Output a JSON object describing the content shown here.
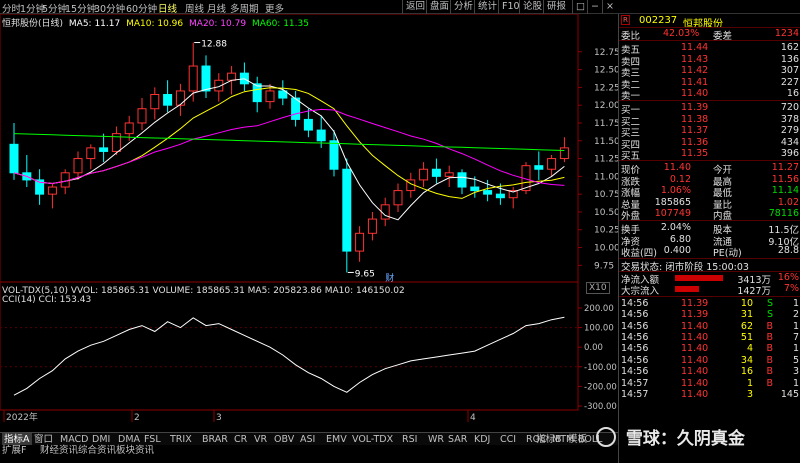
{
  "toolbar": {
    "periods": [
      "分时",
      "1分钟",
      "5分钟",
      "15分钟",
      "30分钟",
      "60分钟",
      "日线",
      "周线",
      "月线",
      "多周期",
      "更多"
    ],
    "active_period": "日线",
    "buttons": [
      "返回",
      "盘面",
      "分析",
      "统计",
      "F10",
      "论股",
      "研报"
    ]
  },
  "chart": {
    "stock_title": "恒邦股份(日线)",
    "ma5": "MA5: 11.17",
    "ma10": "MA10: 10.96",
    "ma20": "MA20: 10.79",
    "ma60": "MA60: 11.35",
    "high_label": "12.88",
    "low_label": "9.65",
    "event_label": "财",
    "price_ticks": [
      "12.75",
      "12.50",
      "12.25",
      "12.00",
      "11.75",
      "11.50",
      "11.25",
      "11.00",
      "10.75",
      "10.50",
      "10.25",
      "10.00",
      "9.75"
    ],
    "vol_line": "VOL-TDX(5,10) VVOL: 185865.31 VOLUME: 185865.31 MA5: 205823.86 MA10: 146150.02",
    "cci_line": "CCI(14) CCI: 153.43",
    "vol_badge": "X10",
    "cci_ticks": [
      "200.00",
      "100.00",
      "0.00",
      "-100.00",
      "-200.00",
      "-300.00"
    ],
    "date_labels": [
      "2022年",
      "2",
      "3",
      "4"
    ],
    "colors": {
      "up": "#ff3333",
      "down": "#00ffff",
      "ma5": "#ffffff",
      "ma10": "#ffff00",
      "ma20": "#ff00ff",
      "ma60": "#00ff00",
      "cci": "#ffffff"
    }
  },
  "chart_data": {
    "type": "candlestick",
    "ylim": [
      9.6,
      13.0
    ],
    "candles": [
      [
        11.45,
        11.75,
        10.95,
        11.05
      ],
      [
        11.05,
        11.3,
        10.85,
        10.95
      ],
      [
        10.95,
        11.1,
        10.6,
        10.75
      ],
      [
        10.75,
        10.9,
        10.55,
        10.85
      ],
      [
        10.85,
        11.1,
        10.75,
        11.05
      ],
      [
        11.05,
        11.35,
        10.95,
        11.25
      ],
      [
        11.25,
        11.45,
        11.1,
        11.4
      ],
      [
        11.4,
        11.6,
        11.2,
        11.35
      ],
      [
        11.35,
        11.7,
        11.3,
        11.6
      ],
      [
        11.6,
        11.85,
        11.5,
        11.75
      ],
      [
        11.75,
        12.1,
        11.65,
        11.95
      ],
      [
        11.95,
        12.25,
        11.8,
        12.15
      ],
      [
        12.15,
        12.35,
        11.9,
        12.0
      ],
      [
        12.0,
        12.3,
        11.85,
        12.2
      ],
      [
        12.2,
        12.88,
        12.05,
        12.55
      ],
      [
        12.55,
        12.7,
        12.1,
        12.2
      ],
      [
        12.2,
        12.45,
        12.05,
        12.35
      ],
      [
        12.35,
        12.55,
        12.15,
        12.45
      ],
      [
        12.45,
        12.6,
        12.2,
        12.3
      ],
      [
        12.3,
        12.4,
        11.9,
        12.05
      ],
      [
        12.05,
        12.3,
        11.95,
        12.2
      ],
      [
        12.2,
        12.35,
        12.0,
        12.1
      ],
      [
        12.1,
        12.2,
        11.7,
        11.8
      ],
      [
        11.8,
        11.95,
        11.55,
        11.65
      ],
      [
        11.65,
        11.85,
        11.4,
        11.5
      ],
      [
        11.5,
        11.65,
        11.0,
        11.1
      ],
      [
        11.1,
        11.25,
        9.65,
        9.95
      ],
      [
        9.95,
        10.3,
        9.8,
        10.2
      ],
      [
        10.2,
        10.5,
        10.1,
        10.4
      ],
      [
        10.4,
        10.7,
        10.3,
        10.6
      ],
      [
        10.6,
        10.9,
        10.5,
        10.8
      ],
      [
        10.8,
        11.05,
        10.7,
        10.95
      ],
      [
        10.95,
        11.2,
        10.85,
        11.1
      ],
      [
        11.1,
        11.25,
        10.9,
        11.0
      ],
      [
        11.0,
        11.15,
        10.85,
        11.05
      ],
      [
        11.05,
        11.1,
        10.75,
        10.85
      ],
      [
        10.85,
        11.0,
        10.7,
        10.8
      ],
      [
        10.8,
        10.95,
        10.65,
        10.75
      ],
      [
        10.75,
        10.9,
        10.6,
        10.7
      ],
      [
        10.7,
        10.85,
        10.55,
        10.8
      ],
      [
        10.8,
        11.2,
        10.75,
        11.15
      ],
      [
        11.15,
        11.35,
        10.95,
        11.1
      ],
      [
        11.1,
        11.3,
        11.0,
        11.25
      ],
      [
        11.25,
        11.55,
        11.2,
        11.4
      ]
    ],
    "cci": [
      -245,
      -210,
      -160,
      -120,
      -60,
      -20,
      10,
      30,
      60,
      90,
      110,
      80,
      130,
      100,
      150,
      110,
      120,
      90,
      60,
      30,
      0,
      -40,
      -90,
      -130,
      -160,
      -200,
      -230,
      -180,
      -140,
      -110,
      -90,
      -70,
      -60,
      -50,
      -40,
      -30,
      -20,
      10,
      40,
      70,
      110,
      120,
      140,
      153
    ]
  },
  "quote": {
    "badge": "R",
    "code": "002237",
    "name": "恒邦股份",
    "weibi_label": "委比",
    "weibi_value": "42.03%",
    "weicha_label": "委差",
    "weicha_value": "1234",
    "sells": [
      {
        "label": "卖五",
        "price": "11.44",
        "vol": "162"
      },
      {
        "label": "卖四",
        "price": "11.43",
        "vol": "136"
      },
      {
        "label": "卖三",
        "price": "11.42",
        "vol": "307"
      },
      {
        "label": "卖二",
        "price": "11.41",
        "vol": "227"
      },
      {
        "label": "卖一",
        "price": "11.40",
        "vol": "16"
      }
    ],
    "buys": [
      {
        "label": "买一",
        "price": "11.39",
        "vol": "720"
      },
      {
        "label": "买二",
        "price": "11.38",
        "vol": "378"
      },
      {
        "label": "买三",
        "price": "11.37",
        "vol": "279"
      },
      {
        "label": "买四",
        "price": "11.36",
        "vol": "434"
      },
      {
        "label": "买五",
        "price": "11.35",
        "vol": "396"
      }
    ],
    "stats": [
      [
        "现价",
        "11.40",
        "今开",
        "11.27"
      ],
      [
        "涨跌",
        "0.12",
        "最高",
        "11.56"
      ],
      [
        "涨幅",
        "1.06%",
        "最低",
        "11.14"
      ],
      [
        "总量",
        "185865",
        "量比",
        "1.02"
      ],
      [
        "外盘",
        "107749",
        "内盘",
        "78116"
      ]
    ],
    "stats2": [
      [
        "换手",
        "2.04%",
        "股本",
        "11.5亿"
      ],
      [
        "净资",
        "6.80",
        "流通",
        "9.10亿"
      ],
      [
        "收益(四)",
        "0.400",
        "PE(动)",
        "28.8"
      ]
    ],
    "status_line": "交易状态: 闭市阶段 15:00:03",
    "flows": [
      {
        "label": "净流入额",
        "value": "3413万",
        "pct": "16%"
      },
      {
        "label": "大宗流入",
        "value": "1427万",
        "pct": "7%"
      }
    ],
    "ticks": [
      [
        "14:56",
        "11.39",
        "10",
        "S",
        "1"
      ],
      [
        "14:56",
        "11.39",
        "31",
        "S",
        "2"
      ],
      [
        "14:56",
        "11.40",
        "62",
        "B",
        "1"
      ],
      [
        "14:56",
        "11.40",
        "51",
        "B",
        "7"
      ],
      [
        "14:56",
        "11.40",
        "4",
        "B",
        "1"
      ],
      [
        "14:56",
        "11.40",
        "34",
        "B",
        "5"
      ],
      [
        "14:56",
        "11.40",
        "16",
        "B",
        "3"
      ],
      [
        "14:57",
        "11.40",
        "1",
        "B",
        "1"
      ],
      [
        "14:57",
        "11.40",
        "3",
        "",
        "145"
      ]
    ]
  },
  "bottom": {
    "tabs": [
      "指标A",
      "窗口",
      "MACD",
      "DMI",
      "DMA",
      "FSL",
      "TRIX",
      "BRAR",
      "CR",
      "VR",
      "OBV",
      "ASI",
      "EMV",
      "VOL-TDX",
      "RSI",
      "WR",
      "SAR",
      "KDJ",
      "CCI",
      "ROC",
      "MTM",
      "BOLL"
    ],
    "right_tabs": [
      "指标B",
      "模板"
    ],
    "tabs2": [
      "扩展F",
      "财经资讯",
      "综合资讯",
      "板块资讯"
    ]
  },
  "watermark": "雪球：久阴真金"
}
